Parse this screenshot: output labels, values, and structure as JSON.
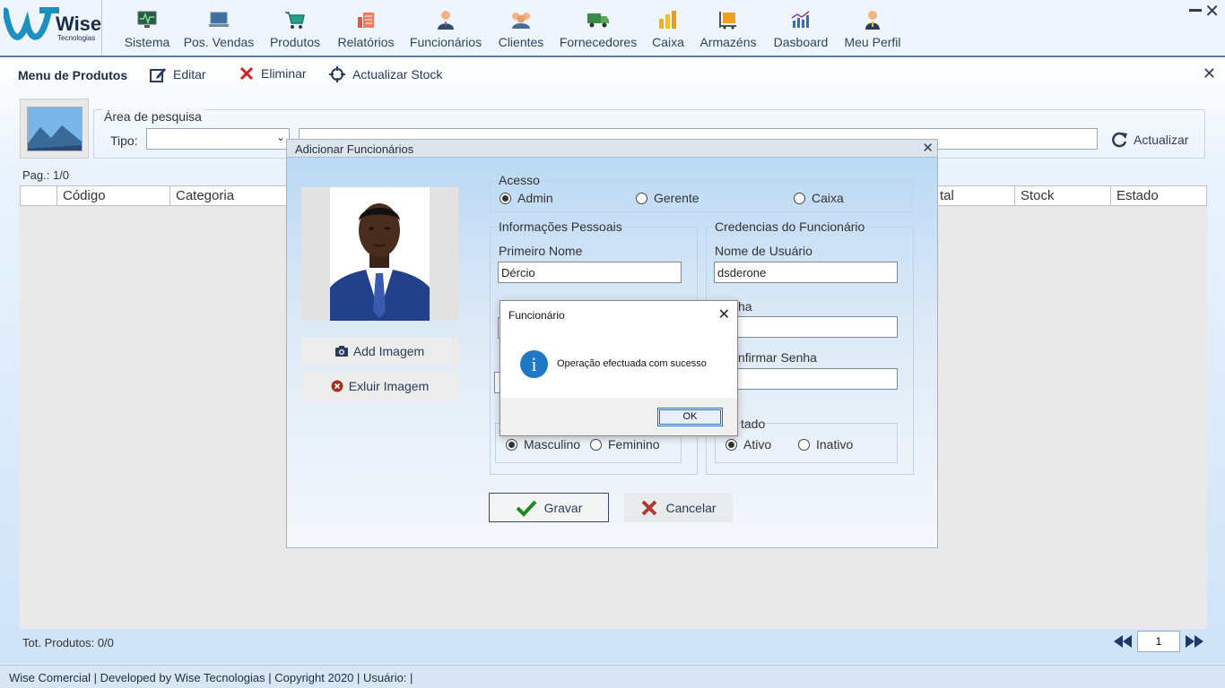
{
  "app": {
    "brand": "Wise",
    "brand_sub": "Tecnologias"
  },
  "nav": [
    {
      "label": "Sistema",
      "icon": "monitor-icon"
    },
    {
      "label": "Pos. Vendas",
      "icon": "laptop-icon"
    },
    {
      "label": "Produtos",
      "icon": "cart-icon"
    },
    {
      "label": "Relatórios",
      "icon": "report-icon"
    },
    {
      "label": "Funcionários",
      "icon": "employee-icon"
    },
    {
      "label": "Clientes",
      "icon": "customers-icon"
    },
    {
      "label": "Fornecedores",
      "icon": "truck-icon"
    },
    {
      "label": "Caixa",
      "icon": "coins-icon"
    },
    {
      "label": "Armazéns",
      "icon": "warehouse-icon"
    },
    {
      "label": "Dasboard",
      "icon": "dashboard-icon"
    },
    {
      "label": "Meu Perfil",
      "icon": "profile-icon"
    }
  ],
  "toolbar": {
    "title": "Menu de Produtos",
    "edit": "Editar",
    "delete": "Eliminar",
    "update_stock": "Actualizar Stock"
  },
  "search": {
    "legend": "Área de pesquisa",
    "type_label": "Tipo:",
    "type_value": "",
    "query": "",
    "refresh": "Actualizar"
  },
  "grid": {
    "page_info": "Pag.: 1/0",
    "columns": [
      "Código",
      "Categoria",
      "tal",
      "Stock",
      "Estado"
    ],
    "total": "Tot. Produtos: 0/0",
    "page_input": "1"
  },
  "status": "Wise Comercial | Developed by Wise Tecnologias | Copyright 2020 | Usuário:   |",
  "dialog": {
    "title": "Adicionar Funcionários",
    "add_image": "Add Imagem",
    "remove_image": "Exluir Imagem",
    "access_legend": "Acesso",
    "access_options": [
      "Admin",
      "Gerente",
      "Caixa"
    ],
    "access_selected": "Admin",
    "personal_legend": "Informações Pessoais",
    "first_name_label": "Primeiro Nome",
    "first_name": "Dércio",
    "credentials_legend": "Credencias do Funcionário",
    "username_label": "Nome de Usuário",
    "username": "dsderone",
    "password_label": "ha",
    "password": "•",
    "confirm_label": "nfirmar Senha",
    "confirm": "•",
    "gender_options": [
      "Masculino",
      "Feminino"
    ],
    "gender_selected": "Masculino",
    "state_label": "tado",
    "state_options": [
      "Ativo",
      "Inativo"
    ],
    "state_selected": "Ativo",
    "save": "Gravar",
    "cancel": "Cancelar"
  },
  "message": {
    "title": "Funcionário",
    "text": "Operação efectuada com sucesso",
    "ok": "OK"
  },
  "colors": {
    "accent": "#2a3c5a",
    "info_icon": "#1f78c6",
    "save_check": "#1e8a1e",
    "cancel_x": "#b03a2e"
  }
}
